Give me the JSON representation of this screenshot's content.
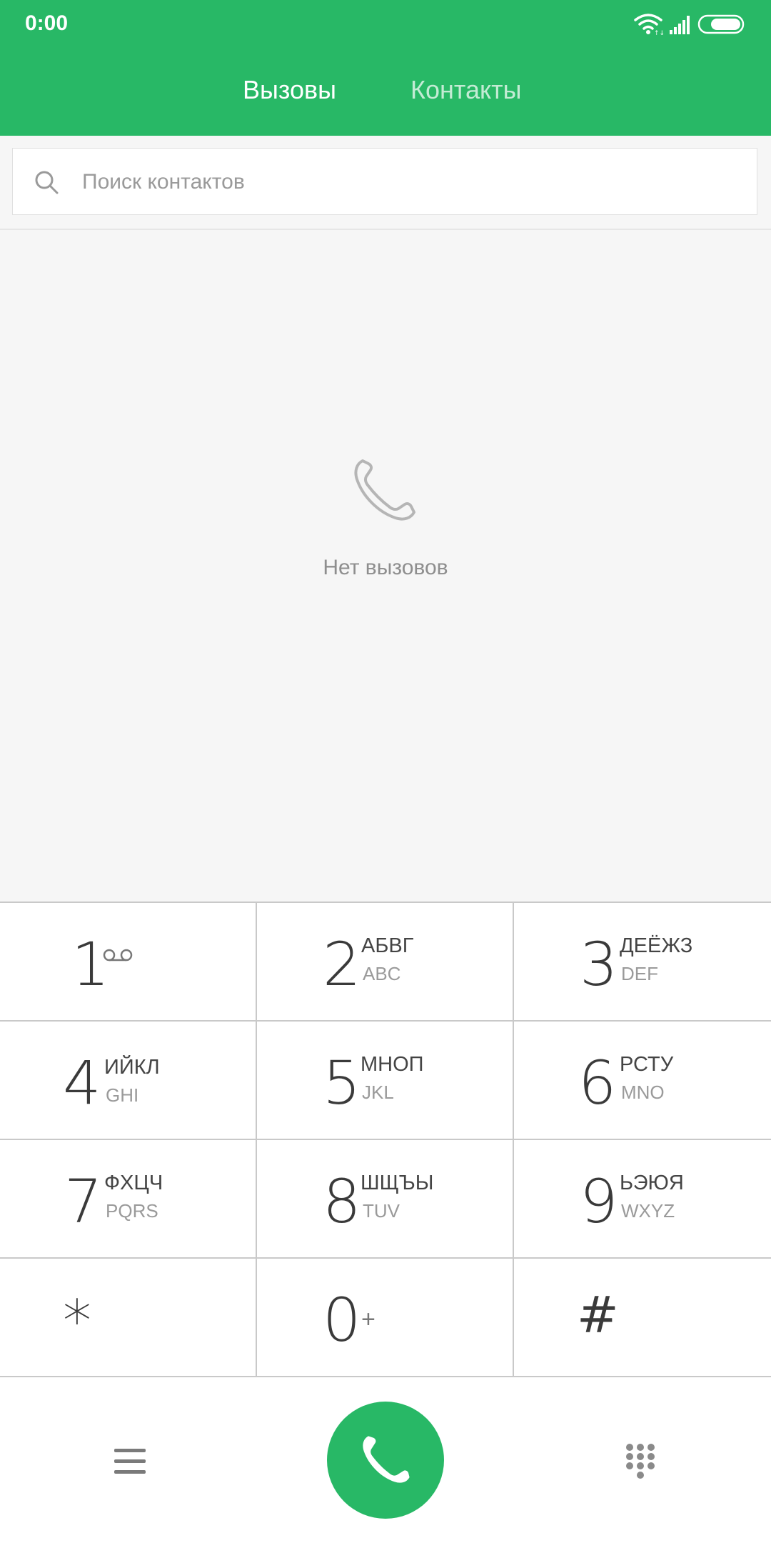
{
  "status_bar": {
    "time": "0:00",
    "icons": [
      "wifi-icon",
      "signal-icon",
      "battery-icon"
    ]
  },
  "tabs": [
    {
      "label": "Вызовы",
      "active": true
    },
    {
      "label": "Контакты",
      "active": false
    }
  ],
  "search": {
    "placeholder": "Поиск контактов",
    "value": ""
  },
  "empty_state": {
    "icon": "phone-icon",
    "text": "Нет вызовов"
  },
  "keypad": {
    "keys": [
      {
        "digit": "1",
        "letters": "",
        "latin": "",
        "extra_icon": "voicemail-icon"
      },
      {
        "digit": "2",
        "letters": "АБВГ",
        "latin": "ABC"
      },
      {
        "digit": "3",
        "letters": "ДЕЁЖЗ",
        "latin": "DEF"
      },
      {
        "digit": "4",
        "letters": "ИЙКЛ",
        "latin": "GHI"
      },
      {
        "digit": "5",
        "letters": "МНОП",
        "latin": "JKL"
      },
      {
        "digit": "6",
        "letters": "РСТУ",
        "latin": "MNO"
      },
      {
        "digit": "7",
        "letters": "ФХЦЧ",
        "latin": "PQRS"
      },
      {
        "digit": "8",
        "letters": "ШЩЪЫ",
        "latin": "TUV"
      },
      {
        "digit": "9",
        "letters": "ЬЭЮЯ",
        "latin": "WXYZ"
      },
      {
        "digit": "*",
        "letters": "",
        "latin": ""
      },
      {
        "digit": "0",
        "letters": "+",
        "latin": ""
      },
      {
        "digit": "#",
        "letters": "",
        "latin": ""
      }
    ]
  },
  "bottom_bar": {
    "icons": [
      "menu-icon",
      "call-icon",
      "dialpad-icon"
    ]
  },
  "colors": {
    "accent": "#28b866",
    "background": "#f6f6f6",
    "divider": "#c9c9c9",
    "text_muted": "#8e8e8e"
  }
}
